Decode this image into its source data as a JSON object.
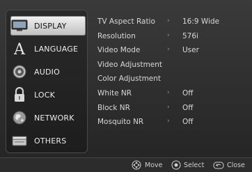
{
  "sidebar": {
    "items": [
      {
        "label": "DISPLAY",
        "icon": "tv-icon",
        "active": true
      },
      {
        "label": "LANGUAGE",
        "icon": "letter-a-icon",
        "active": false
      },
      {
        "label": "AUDIO",
        "icon": "speaker-icon",
        "active": false
      },
      {
        "label": "LOCK",
        "icon": "padlock-icon",
        "active": false
      },
      {
        "label": "NETWORK",
        "icon": "globe-icon",
        "active": false
      },
      {
        "label": "OTHERS",
        "icon": "box-icon",
        "active": false
      }
    ]
  },
  "settings": {
    "rows": [
      {
        "label": "TV Aspect Ratio",
        "arrow": "›",
        "value": "16:9 Wide"
      },
      {
        "label": "Resolution",
        "arrow": "›",
        "value": "576i"
      },
      {
        "label": "Video Mode",
        "arrow": "›",
        "value": "User"
      },
      {
        "label": "Video Adjustment",
        "arrow": "",
        "value": ""
      },
      {
        "label": "Color Adjustment",
        "arrow": "",
        "value": ""
      },
      {
        "label": "White NR",
        "arrow": "›",
        "value": "Off"
      },
      {
        "label": "Block NR",
        "arrow": "›",
        "value": "Off"
      },
      {
        "label": "Mosquito NR",
        "arrow": "›",
        "value": "Off"
      }
    ]
  },
  "help": {
    "move": "Move",
    "select": "Select",
    "close": "Close"
  },
  "colors": {
    "active_bg": "#d9d9d9",
    "text": "#ececec",
    "background": "#2a2a2a"
  }
}
